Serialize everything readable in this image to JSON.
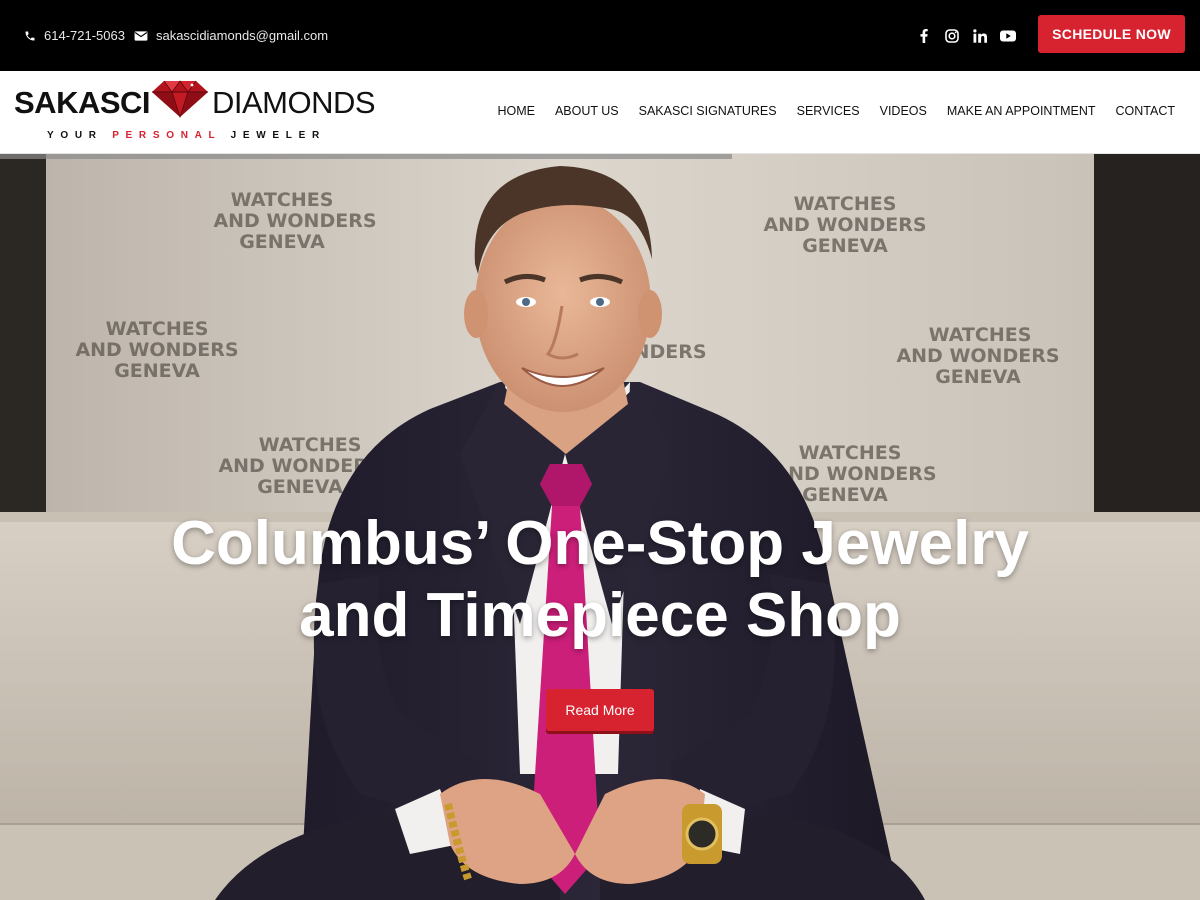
{
  "topbar": {
    "phone": "614-721-5063",
    "email": "sakascidiamonds@gmail.com",
    "social": [
      "facebook-icon",
      "instagram-icon",
      "linkedin-icon",
      "youtube-icon"
    ],
    "schedule_label": "SCHEDULE NOW"
  },
  "logo": {
    "word1": "SAKASCI",
    "word2": "DIAMONDS",
    "tag_before": "YOUR",
    "tag_red": "PERSONAL",
    "tag_after": "JEWELER"
  },
  "nav": {
    "items": [
      "HOME",
      "ABOUT US",
      "SAKASCI SIGNATURES",
      "SERVICES",
      "VIDEOS",
      "MAKE AN APPOINTMENT",
      "CONTACT"
    ]
  },
  "hero": {
    "backdrop_text": "WATCHES AND WONDERS GENEVA",
    "heading_line1": "Columbus’ One-Stop Jewelry",
    "heading_line2": "and Timepiece Shop",
    "button_label": "Read More"
  },
  "colors": {
    "accent": "#d7222f",
    "topbar_bg": "#000000",
    "header_bg": "#ffffff"
  }
}
